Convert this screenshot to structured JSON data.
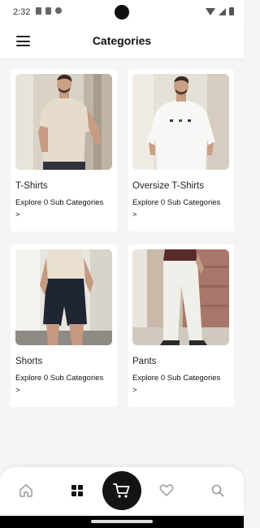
{
  "status": {
    "time": "2:32"
  },
  "header": {
    "title": "Categories",
    "menu_icon": "hamburger-menu-icon"
  },
  "categories": [
    {
      "name": "T-Shirts",
      "link": "Explore 0 Sub Categories >",
      "image": "man-beige-tshirt-photo"
    },
    {
      "name": "Oversize T-Shirts",
      "link": "Explore 0 Sub Categories >",
      "image": "man-white-oversize-tshirt-photo"
    },
    {
      "name": "Shorts",
      "link": "Explore 0 Sub Categories >",
      "image": "man-navy-shorts-photo"
    },
    {
      "name": "Pants",
      "link": "Explore 0 Sub Categories >",
      "image": "man-white-pants-photo"
    }
  ],
  "bottom_nav": {
    "items": [
      "home-icon",
      "categories-grid-icon",
      "cart-icon",
      "heart-icon",
      "search-icon"
    ],
    "active": "categories-grid-icon"
  },
  "colors": {
    "background": "#f5f5f5",
    "card": "#ffffff",
    "fab": "#141414",
    "inactive_icon": "#9a9a9a"
  }
}
